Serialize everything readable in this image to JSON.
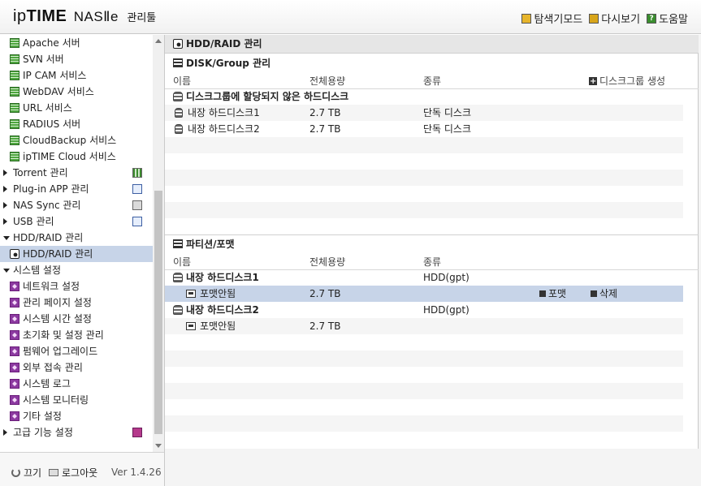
{
  "header": {
    "logo_ip": "ip",
    "logo_time": "TIME",
    "logo_nas": "NASⅡe",
    "logo_admin": "관리툴",
    "menu": [
      {
        "label": "탐색기모드",
        "icon": "explorer-icon"
      },
      {
        "label": "다시보기",
        "icon": "refresh-icon"
      },
      {
        "label": "도움말",
        "icon": "help-icon"
      }
    ]
  },
  "sidebar": {
    "items": [
      {
        "label": "Apache 서버",
        "icon": "service-icon"
      },
      {
        "label": "SVN 서버",
        "icon": "service-icon"
      },
      {
        "label": "IP CAM 서비스",
        "icon": "service-icon"
      },
      {
        "label": "WebDAV 서비스",
        "icon": "service-icon"
      },
      {
        "label": "URL 서비스",
        "icon": "service-icon"
      },
      {
        "label": "RADIUS 서버",
        "icon": "service-icon"
      },
      {
        "label": "CloudBackup 서비스",
        "icon": "service-icon"
      },
      {
        "label": "ipTIME Cloud 서비스",
        "icon": "service-icon"
      },
      {
        "label": "Torrent 관리"
      },
      {
        "label": "Plug-in APP 관리"
      },
      {
        "label": "NAS Sync 관리"
      },
      {
        "label": "USB 관리"
      },
      {
        "label": "HDD/RAID 관리"
      },
      {
        "label": "HDD/RAID 관리"
      },
      {
        "label": "시스템 설정"
      },
      {
        "label": "네트워크 설정"
      },
      {
        "label": "관리 페이지 설정"
      },
      {
        "label": "시스템 시간 설정"
      },
      {
        "label": "초기화 및 설정 관리"
      },
      {
        "label": "펌웨어 업그레이드"
      },
      {
        "label": "외부 접속 관리"
      },
      {
        "label": "시스템 로그"
      },
      {
        "label": "시스템 모니터링"
      },
      {
        "label": "기타 설정"
      },
      {
        "label": "고급 기능 설정"
      }
    ],
    "footer": {
      "power": "끄기",
      "logout": "로그아웃",
      "version": "Ver 1.4.26"
    }
  },
  "main": {
    "title": "HDD/RAID 관리",
    "disk_section": {
      "title": "DISK/Group 관리",
      "headers": {
        "name": "이름",
        "capacity": "전체용량",
        "type": "종류"
      },
      "create_label": "디스크그룹 생성",
      "unassigned_label": "디스크그룹에 할당되지 않은 하드디스크",
      "rows": [
        {
          "name": "내장 하드디스크1",
          "capacity": "2.7 TB",
          "type": "단독 디스크"
        },
        {
          "name": "내장 하드디스크2",
          "capacity": "2.7 TB",
          "type": "단독 디스크"
        }
      ]
    },
    "partition_section": {
      "title": "파티션/포맷",
      "headers": {
        "name": "이름",
        "capacity": "전체용량",
        "type": "종류"
      },
      "disks": [
        {
          "name": "내장 하드디스크1",
          "type": "HDD(gpt)",
          "partition": {
            "name": "포맷안됨",
            "capacity": "2.7 TB",
            "format_label": "포맷",
            "delete_label": "삭제"
          }
        },
        {
          "name": "내장 하드디스크2",
          "type": "HDD(gpt)",
          "partition": {
            "name": "포맷안됨",
            "capacity": "2.7 TB"
          }
        }
      ]
    }
  }
}
